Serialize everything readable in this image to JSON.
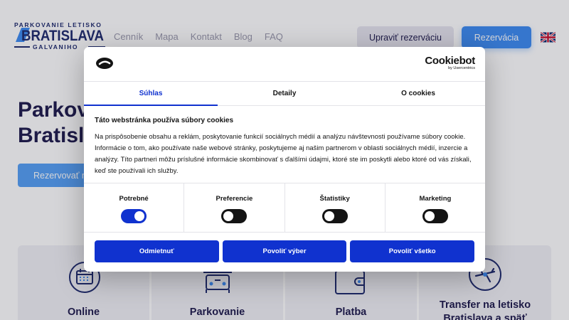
{
  "logo": {
    "top": "PARKOVANIE LETISKO",
    "main": "BRATISLAVA",
    "bottom": "GALVANIHO"
  },
  "nav": [
    "Cenník",
    "Mapa",
    "Kontakt",
    "Blog",
    "FAQ"
  ],
  "header": {
    "edit_label": "Upraviť rezerváciu",
    "reserve_label": "Rezervácia",
    "language_icon": "uk-flag-icon"
  },
  "hero": {
    "title_line1": "Parkov",
    "title_line2": "Bratisla",
    "cta": "Rezervovať mi"
  },
  "cards": [
    {
      "line1": "Online",
      "icon": "calendar-icon"
    },
    {
      "line1": "Parkovanie",
      "icon": "parking-icon"
    },
    {
      "line1": "Platba",
      "icon": "wallet-icon"
    },
    {
      "line1": "Transfer na letisko",
      "line2": "Bratislava a späť",
      "icon": "airplane-icon"
    }
  ],
  "cookie_dialog": {
    "brand": "Cookiebot",
    "brand_sub": "by Usercentrics",
    "tabs": [
      "Súhlas",
      "Detaily",
      "O cookies"
    ],
    "active_tab": "Súhlas",
    "heading": "Táto webstránka používa súbory cookies",
    "body": "Na prispôsobenie obsahu a reklám, poskytovanie funkcií sociálnych médií a analýzu návštevnosti používame súbory cookie. Informácie o tom, ako používate naše webové stránky, poskytujeme aj našim partnerom v oblasti sociálnych médií, inzercie a analýzy. Títo partneri môžu príslušné informácie skombinovať s ďalšími údajmi, ktoré ste im poskytli alebo ktoré od vás získali, keď ste používali ich služby.",
    "toggles": [
      {
        "label": "Potrebné",
        "on": true
      },
      {
        "label": "Preferencie",
        "on": false
      },
      {
        "label": "Štatistiky",
        "on": false
      },
      {
        "label": "Marketing",
        "on": false
      }
    ],
    "buttons": {
      "deny": "Odmietnuť",
      "allow_selection": "Povoliť výber",
      "allow_all": "Povoliť všetko"
    }
  },
  "colors": {
    "primary_blue": "#1032cf",
    "brand_navy": "#1f2b6e",
    "header_button_blue": "#3d8bf2"
  }
}
